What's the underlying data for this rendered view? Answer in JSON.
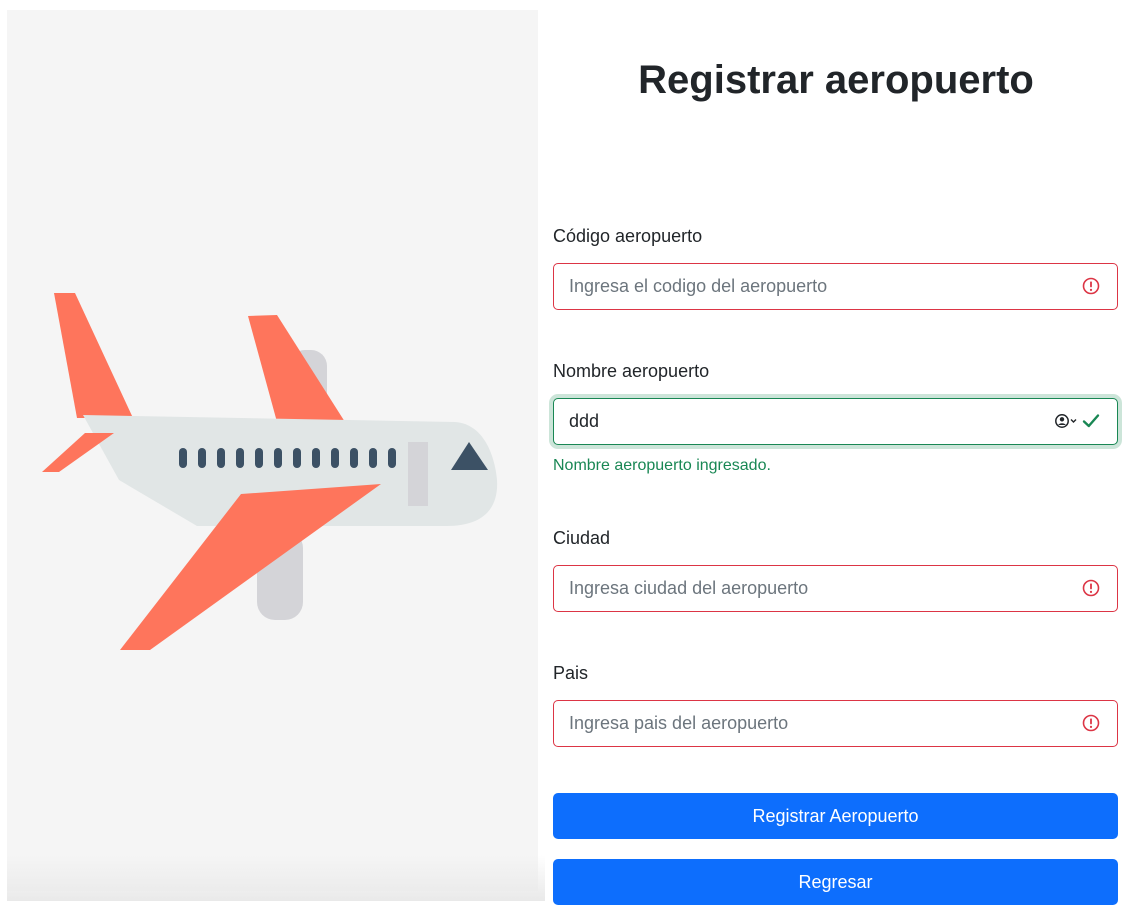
{
  "page": {
    "title": "Registrar aeropuerto"
  },
  "form": {
    "codigo": {
      "label": "Código aeropuerto",
      "value": "",
      "placeholder": "Ingresa el codigo del aeropuerto",
      "state": "invalid"
    },
    "nombre": {
      "label": "Nombre aeropuerto",
      "value": "ddd",
      "placeholder": "",
      "state": "valid",
      "feedback": "Nombre aeropuerto ingresado."
    },
    "ciudad": {
      "label": "Ciudad",
      "value": "",
      "placeholder": "Ingresa ciudad del aeropuerto",
      "state": "invalid"
    },
    "pais": {
      "label": "Pais",
      "value": "",
      "placeholder": "Ingresa pais del aeropuerto",
      "state": "invalid"
    }
  },
  "buttons": {
    "submit_label": "Registrar Aeropuerto",
    "back_label": "Regresar"
  },
  "icons": {
    "invalid": "exclamation-circle-icon",
    "valid": "check-icon",
    "autofill": "contact-autofill-icon"
  },
  "colors": {
    "primary": "#0d6efd",
    "invalid": "#dc3545",
    "valid": "#198754",
    "plane_wing": "#fe755c",
    "plane_body": "#e1e6e6",
    "plane_window": "#3c5165"
  }
}
